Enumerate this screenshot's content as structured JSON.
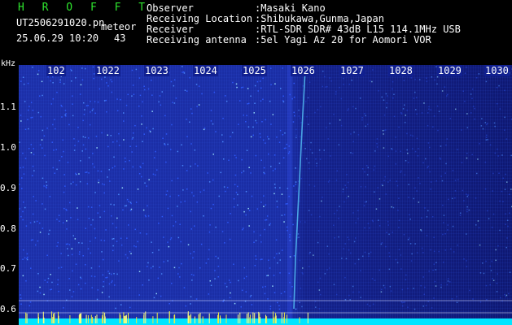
{
  "header": {
    "brand": "H R O F F T",
    "filename": "UT2506291020.pn",
    "mode": "meteor",
    "datetime": "25.06.29 10:20",
    "count": "43",
    "metadata": [
      {
        "key": "Observer",
        "value": ":Masaki Kano"
      },
      {
        "key": "Receiving Location",
        "value": ":Shibukawa,Gunma,Japan"
      },
      {
        "key": "Receiver",
        "value": ":RTL-SDR SDR# 43dB L15 114.1MHz USB"
      },
      {
        "key": "Receiving antenna",
        "value": ":5el Yagi Az 20 for Aomori VOR"
      }
    ]
  },
  "axes": {
    "y_unit": "kHz",
    "y_ticks": [
      "1.1",
      "1.0",
      "0.9",
      "0.8",
      "0.7",
      "0.6"
    ],
    "x_ticks": [
      "102",
      "1022",
      "1023",
      "1024",
      "1025",
      "1026",
      "1027",
      "1028",
      "1029",
      "1030"
    ]
  },
  "colors": {
    "background": "#000000",
    "brand": "#2ee62e",
    "waterfall_high": "#1c2fa8",
    "waterfall_low": "#0e1872",
    "baseline": "#00e5ff",
    "meteor": "#5bd0ff"
  }
}
